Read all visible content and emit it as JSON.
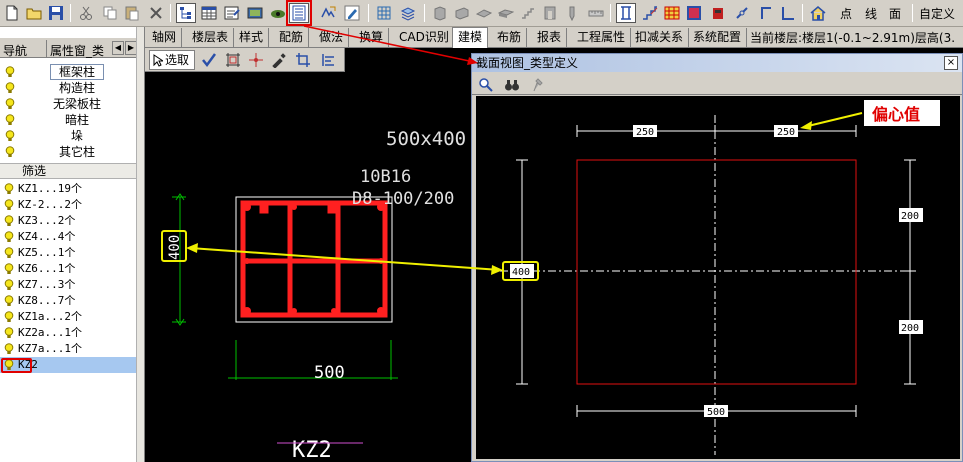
{
  "toolbar": {
    "icons": [
      "new-file-icon",
      "open-folder-icon",
      "save-icon",
      "cut-icon",
      "copy-icon",
      "paste-icon",
      "delete-icon",
      "select-layer-icon",
      "table-icon",
      "properties-icon",
      "view-icon",
      "eye-icon",
      "section-view-icon",
      "define-icon",
      "edit-icon",
      "grid-icon",
      "layers-icon"
    ],
    "point_label": "点",
    "line_label": "线",
    "face_label": "面",
    "custom_label": "自定义"
  },
  "left_panel": {
    "tab_nav": "导航",
    "tab_props": "属性窗_类",
    "types": [
      "框架柱",
      "构造柱",
      "无梁板柱",
      "暗柱",
      "垛",
      "其它柱"
    ],
    "selected_type": "框架柱",
    "filter_label": "筛选",
    "components": [
      "KZ1...19个",
      "KZ-2...2个",
      "KZ3...2个",
      "KZ4...4个",
      "KZ5...1个",
      "KZ6...1个",
      "KZ7...3个",
      "KZ8...7个",
      "KZ1a...2个",
      "KZ2a...1个",
      "KZ7a...1个",
      "KZ2"
    ],
    "selected_component": "KZ2"
  },
  "menu_tabs": [
    "轴网",
    "楼层表",
    "样式",
    "配筋",
    "做法",
    "换算",
    "CAD识别",
    "建模",
    "布筋",
    "报表",
    "工程属性",
    "扣减关系",
    "系统配置"
  ],
  "active_tab": "建模",
  "floor_info": "当前楼层:楼层1(-0.1~2.91m)层高(3.",
  "cad_tools": {
    "select_label": "选取"
  },
  "drawing": {
    "size_label": "500x400",
    "rebar_label": "10B16",
    "stirrup_label": "D8-100/200",
    "dim_width": "500",
    "dim_height": "400",
    "column_name": "KZ2"
  },
  "dialog": {
    "title": "截面视图_类型定义",
    "close_label": "×",
    "dim_top_left": "250",
    "dim_top_right": "250",
    "dim_right_top": "200",
    "dim_right_bottom": "200",
    "dim_left": "400",
    "dim_bottom": "500"
  },
  "annotation": {
    "eccentric_label": "偏心值"
  },
  "colors": {
    "accent_red": "#e00000",
    "highlight_yellow": "#f0f000",
    "rebar_red": "#ff2020",
    "dim_green": "#00c000"
  }
}
